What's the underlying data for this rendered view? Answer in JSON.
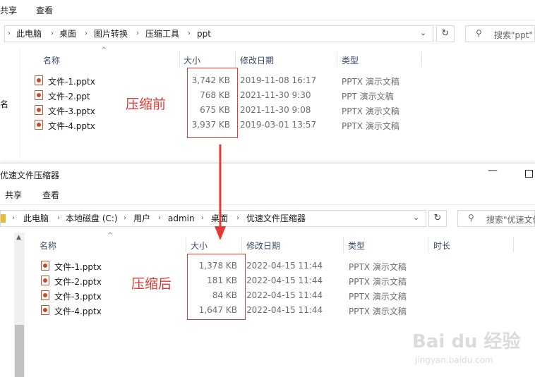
{
  "win1": {
    "menu": [
      "共享",
      "查看"
    ],
    "breadcrumb": [
      "此电脑",
      "桌面",
      "图片转换",
      "压缩工具",
      "ppt"
    ],
    "search_placeholder": "搜索\"ppt\"",
    "columns": [
      "名称",
      "大小",
      "修改日期",
      "类型"
    ],
    "left_pane_label": "名",
    "files": [
      {
        "name": "文件-1.pptx",
        "size": "3,742 KB",
        "date": "2019-11-08 16:17",
        "type": "PPTX 演示文稿"
      },
      {
        "name": "文件-2.ppt",
        "size": "768 KB",
        "date": "2021-11-30 9:30",
        "type": "PPT 演示文稿"
      },
      {
        "name": "文件-3.pptx",
        "size": "675 KB",
        "date": "2021-11-30 9:08",
        "type": "PPTX 演示文稿"
      },
      {
        "name": "文件-4.pptx",
        "size": "3,937 KB",
        "date": "2019-03-01 13:57",
        "type": "PPTX 演示文稿"
      }
    ],
    "annotation": "压缩前"
  },
  "win2": {
    "title": "优速文件压缩器",
    "menu": [
      "共享",
      "查看"
    ],
    "breadcrumb": [
      "此电脑",
      "本地磁盘 (C:)",
      "用户",
      "admin",
      "桌面",
      "优速文件压缩器"
    ],
    "search_placeholder": "搜索\"优速文件",
    "columns": [
      "名称",
      "大小",
      "修改日期",
      "类型",
      "时长"
    ],
    "files": [
      {
        "name": "文件-1.pptx",
        "size": "1,378 KB",
        "date": "2022-04-15 11:44",
        "type": "PPTX 演示文稿"
      },
      {
        "name": "文件-2.pptx",
        "size": "181 KB",
        "date": "2022-04-15 11:44",
        "type": "PPTX 演示文稿"
      },
      {
        "name": "文件-3.pptx",
        "size": "84 KB",
        "date": "2022-04-15 11:44",
        "type": "PPTX 演示文稿"
      },
      {
        "name": "文件-4.pptx",
        "size": "1,647 KB",
        "date": "2022-04-15 11:44",
        "type": "PPTX 演示文稿"
      }
    ],
    "annotation": "压缩后"
  },
  "watermark": {
    "brand": "Bai du 经验",
    "url": "jingyan.baidu.com"
  },
  "colors": {
    "annotation_red": "#e53935",
    "ppt_icon": "#d24726"
  }
}
